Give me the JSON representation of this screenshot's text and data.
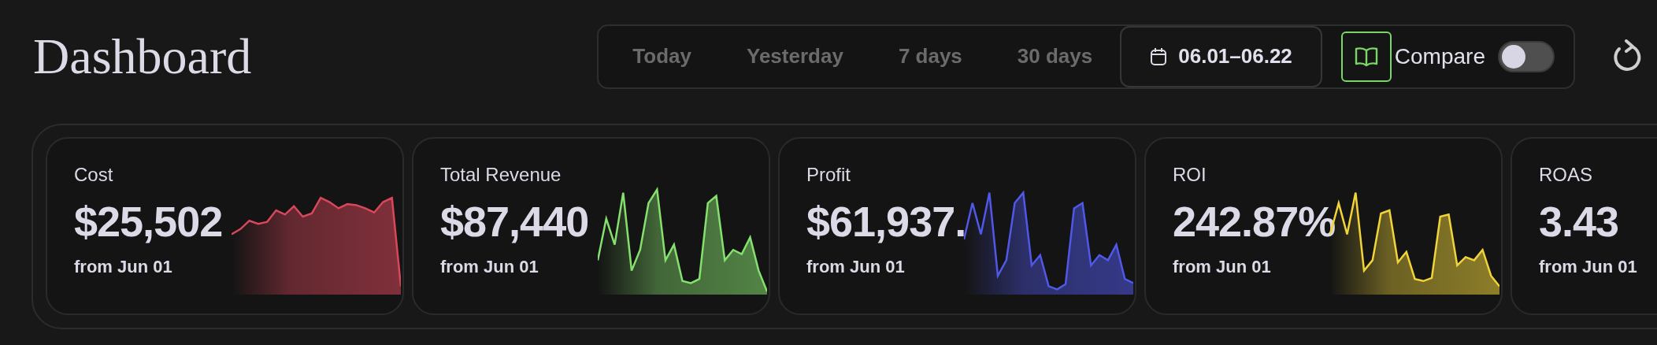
{
  "title": "Dashboard",
  "range_tabs": [
    {
      "label": "Today",
      "selected": false,
      "kind": "preset"
    },
    {
      "label": "Yesterday",
      "selected": false,
      "kind": "preset"
    },
    {
      "label": "7 days",
      "selected": false,
      "kind": "preset"
    },
    {
      "label": "30 days",
      "selected": false,
      "kind": "preset"
    },
    {
      "label": "06.01–06.22",
      "selected": true,
      "kind": "range"
    }
  ],
  "compare": {
    "label": "Compare",
    "on": false
  },
  "cards": [
    {
      "title": "Cost",
      "value": "$25,502",
      "note": "from Jun 01",
      "color": "#d9475a"
    },
    {
      "title": "Total Revenue",
      "value": "$87,440",
      "note": "from Jun 01",
      "color": "#86e06e"
    },
    {
      "title": "Profit",
      "value": "$61,937.",
      "note": "from Jun 01",
      "color": "#5058e8"
    },
    {
      "title": "ROI",
      "value": "242.87%",
      "note": "from Jun 01",
      "color": "#f0d43a"
    },
    {
      "title": "ROAS",
      "value": "3.43",
      "note": "from Jun 01"
    }
  ]
}
